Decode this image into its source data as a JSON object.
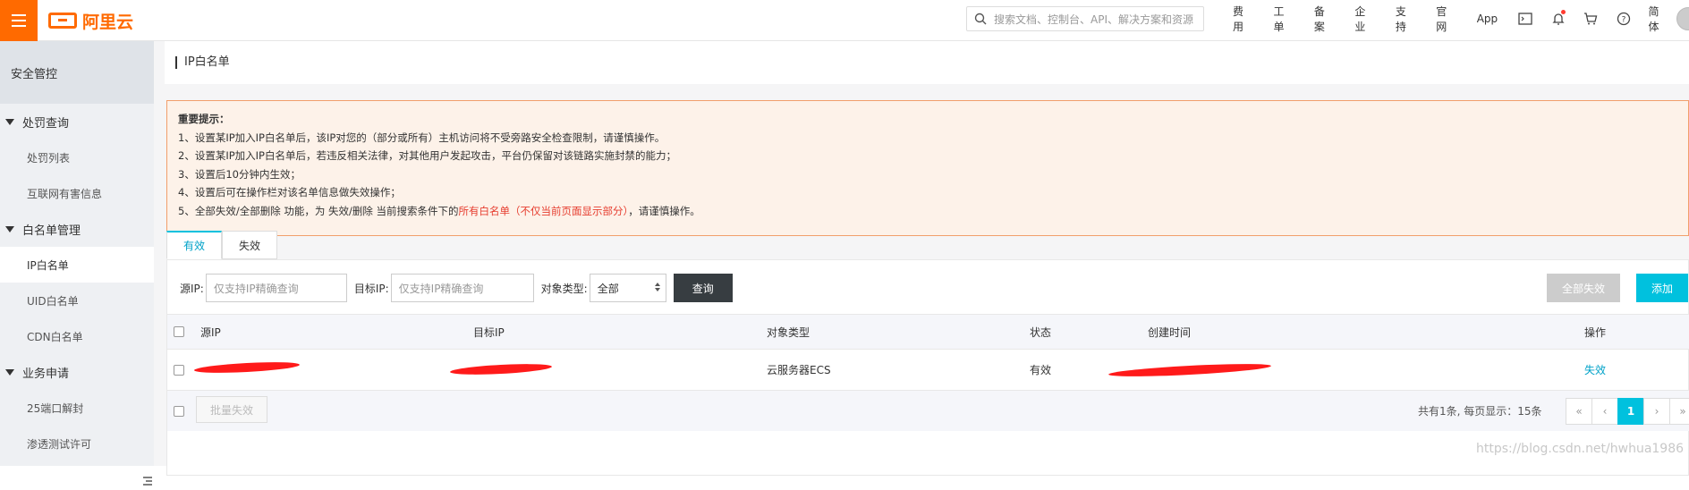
{
  "brand": {
    "logo_text": "阿里云",
    "accent": "#ff6a00"
  },
  "search": {
    "placeholder": "搜索文档、控制台、API、解决方案和资源"
  },
  "nav": {
    "items": [
      "费用",
      "工单",
      "备案",
      "企业",
      "支持",
      "官网",
      "App"
    ],
    "lang": "简体"
  },
  "sidebar": {
    "title": "安全管控",
    "groups": [
      {
        "label": "处罚查询",
        "items": [
          "处罚列表",
          "互联网有害信息"
        ]
      },
      {
        "label": "白名单管理",
        "items": [
          "IP白名单",
          "UID白名单",
          "CDN白名单"
        ]
      },
      {
        "label": "业务申请",
        "items": [
          "25端口解封",
          "渗透测试许可"
        ]
      }
    ],
    "active_item": "IP白名单"
  },
  "page": {
    "title": "IP白名单"
  },
  "notice": {
    "heading": "重要提示：",
    "lines": [
      "1、设置某IP加入IP白名单后，该IP对您的（部分或所有）主机访问将不受旁路安全检查限制，请谨慎操作。",
      "2、设置某IP加入IP白名单后，若违反相关法律，对其他用户发起攻击，平台仍保留对该链路实施封禁的能力；",
      "3、设置后10分钟内生效；",
      "4、设置后可在操作栏对该名单信息做失效操作；"
    ],
    "line5_prefix": "5、全部失效/全部删除 功能，为 失效/删除 当前搜索条件下的",
    "line5_red": "所有白名单（不仅当前页面显示部分）",
    "line5_suffix": "，请谨慎操作。"
  },
  "tabs": {
    "active": "有效",
    "inactive": "失效"
  },
  "filter": {
    "source_label": "源IP:",
    "source_placeholder": "仅支持IP精确查询",
    "target_label": "目标IP:",
    "target_placeholder": "仅支持IP精确查询",
    "type_label": "对象类型:",
    "type_value": "全部",
    "query_button": "查询"
  },
  "actions": {
    "disable_all": "全部失效",
    "add": "添加"
  },
  "table": {
    "headers": [
      "源IP",
      "目标IP",
      "对象类型",
      "状态",
      "创建时间",
      "操作"
    ],
    "rows": [
      {
        "source_ip": "",
        "target_ip": "",
        "object_type": "云服务器ECS",
        "status": "有效",
        "created": "",
        "action": "失效"
      }
    ]
  },
  "footer": {
    "batch_button": "批量失效",
    "page_info": "共有1条, 每页显示：15条",
    "pager": [
      "«",
      "‹",
      "1",
      "›",
      "»"
    ]
  },
  "watermark": "https://blog.csdn.net/hwhua1986"
}
